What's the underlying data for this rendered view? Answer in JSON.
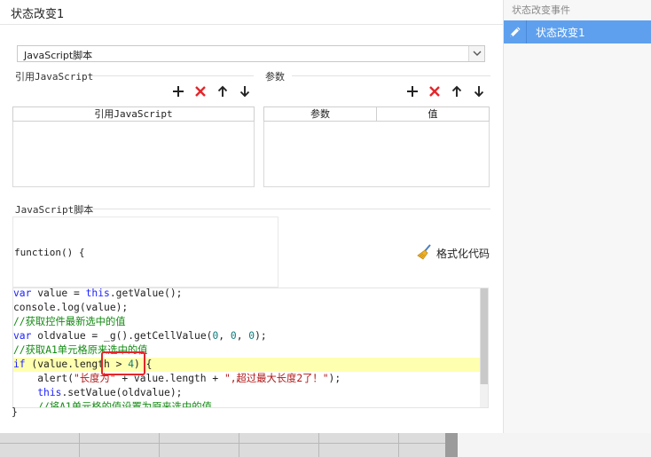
{
  "panel": {
    "title": "状态改变1",
    "script_type_selected": "JavaScript脚本",
    "ref_js_label": "引用JavaScript",
    "params_label": "参数",
    "ref_table_header": "引用JavaScript",
    "params_table_headers": [
      "参数",
      "值"
    ],
    "js_script_label": "JavaScript脚本",
    "function_header": "function() {",
    "format_code_label": "格式化代码",
    "closing_brace": "}"
  },
  "code": {
    "lines": [
      "var value = this.getValue();",
      "console.log(value);",
      "//获取控件最新选中的值",
      "var oldvalue = _g().getCellValue(0, 0, 0);",
      "//获取A1单元格原来选中的值",
      "if (value.length > 4) {",
      "    alert(\"长度为\" + value.length + \",超过最大长度2了！\");",
      "    this.setValue(oldvalue);",
      "    //将A1单元格的值设置为原来选中的值"
    ],
    "highlighted_line_index": 5
  },
  "side_panel": {
    "title": "状态改变事件",
    "items": [
      {
        "label": "状态改变1",
        "selected": true
      }
    ]
  },
  "colors": {
    "accent": "#5ea0ee",
    "delete_red": "#e3262a",
    "keyword": "#1e22ff",
    "comment": "#128a12",
    "string": "#b01515",
    "line_highlight": "#ffffb0"
  },
  "icons": {
    "toolbar": [
      "plus-icon",
      "delete-x-icon",
      "arrow-up-icon",
      "arrow-down-icon"
    ],
    "format": "broom-icon",
    "select_arrow": "chevron-down-icon",
    "side_item": "pencil-icon"
  }
}
